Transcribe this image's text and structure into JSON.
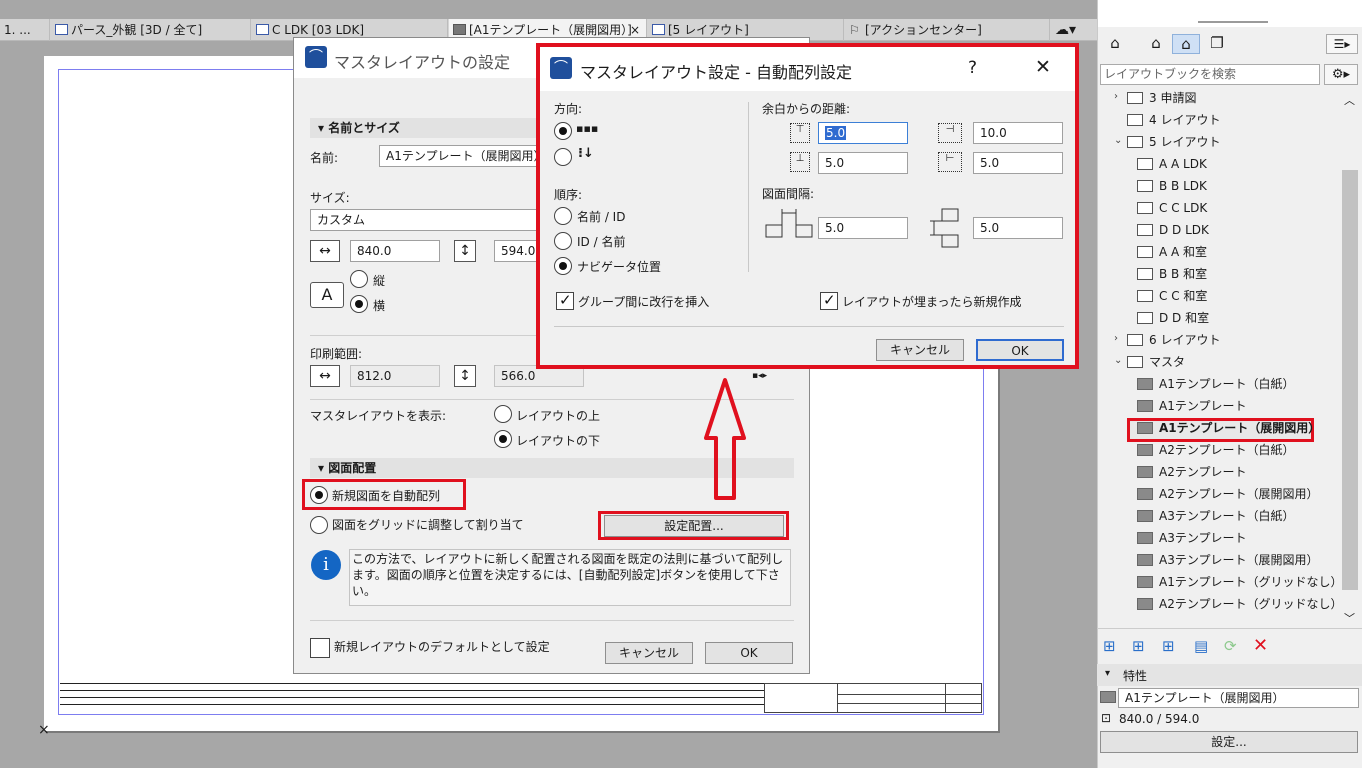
{
  "tabs": [
    {
      "label": "1. ..."
    },
    {
      "label": "パース_外観 [3D / 全て]"
    },
    {
      "label": "C LDK [03 LDK]"
    },
    {
      "label": "[A1テンプレート（展開図用）]"
    },
    {
      "label": "[5 レイアウト]"
    },
    {
      "label": "[アクションセンター]"
    }
  ],
  "tab_close": "×",
  "master_dialog": {
    "title": "マスタレイアウトの設定",
    "section_name_size": "名前とサイズ",
    "name_label": "名前:",
    "name_value": "A1テンプレート（展開図用）",
    "size_label": "サイズ:",
    "size_value": "カスタム",
    "width": "840.0",
    "height": "594.0",
    "portrait": "縦",
    "landscape": "横",
    "print_label": "印刷範囲:",
    "print_w": "812.0",
    "print_h": "566.0",
    "show_label": "マスタレイアウトを表示:",
    "show_above": "レイアウトの上",
    "show_below": "レイアウトの下",
    "section_placement": "図面配置",
    "auto_arrange": "新規図面を自動配列",
    "grid_fit": "図面をグリッドに調整して割り当て",
    "settings_button": "設定配置...",
    "info_text": "この方法で、レイアウトに新しく配置される図面を既定の法則に基づいて配列します。図面の順序と位置を決定するには、[自動配列設定]ボタンを使用して下さい。",
    "default_check": "新規レイアウトのデフォルトとして設定",
    "cancel": "キャンセル",
    "ok": "OK"
  },
  "auto_dialog": {
    "title": "マスタレイアウト設定 - 自動配列設定",
    "help": "?",
    "close": "✕",
    "direction_label": "方向:",
    "order_label": "順序:",
    "order_name_id": "名前 / ID",
    "order_id_name": "ID / 名前",
    "order_nav": "ナビゲータ位置",
    "margin_label": "余白からの距離:",
    "margin_top": "5.0",
    "margin_right": "10.0",
    "margin_bottom": "5.0",
    "margin_left": "5.0",
    "gap_label": "図面間隔:",
    "gap_h": "5.0",
    "gap_v": "5.0",
    "group_break": "グループ間に改行を挿入",
    "new_layout": "レイアウトが埋まったら新規作成",
    "cancel": "キャンセル",
    "ok": "OK"
  },
  "right_panel": {
    "search_placeholder": "レイアウトブックを検索",
    "tree": [
      {
        "label": "3 申請図",
        "type": "folder"
      },
      {
        "label": "4 レイアウト",
        "type": "layout"
      },
      {
        "label": "5 レイアウト",
        "type": "layout"
      },
      {
        "label": "A A LDK",
        "type": "drawing"
      },
      {
        "label": "B B LDK",
        "type": "drawing"
      },
      {
        "label": "C C LDK",
        "type": "drawing"
      },
      {
        "label": "D D LDK",
        "type": "drawing"
      },
      {
        "label": "A A 和室",
        "type": "drawing"
      },
      {
        "label": "B B 和室",
        "type": "drawing"
      },
      {
        "label": "C C 和室",
        "type": "drawing"
      },
      {
        "label": "D D 和室",
        "type": "drawing"
      },
      {
        "label": "6 レイアウト",
        "type": "layout"
      },
      {
        "label": "マスタ",
        "type": "folder"
      },
      {
        "label": "A1テンプレート（白紙）",
        "type": "master"
      },
      {
        "label": "A1テンプレート",
        "type": "master"
      },
      {
        "label": "A1テンプレート（展開図用）",
        "type": "master",
        "selected": true
      },
      {
        "label": "A2テンプレート（白紙）",
        "type": "master"
      },
      {
        "label": "A2テンプレート",
        "type": "master"
      },
      {
        "label": "A2テンプレート（展開図用）",
        "type": "master"
      },
      {
        "label": "A3テンプレート（白紙）",
        "type": "master"
      },
      {
        "label": "A3テンプレート",
        "type": "master"
      },
      {
        "label": "A3テンプレート（展開図用）",
        "type": "master"
      },
      {
        "label": "A1テンプレート（グリッドなし）",
        "type": "master"
      },
      {
        "label": "A2テンプレート（グリッドなし）",
        "type": "master"
      }
    ],
    "properties_label": "特性",
    "prop_name": "A1テンプレート（展開図用）",
    "prop_size": "840.0 / 594.0",
    "settings_button": "設定...",
    "delete_icon": "✕"
  }
}
